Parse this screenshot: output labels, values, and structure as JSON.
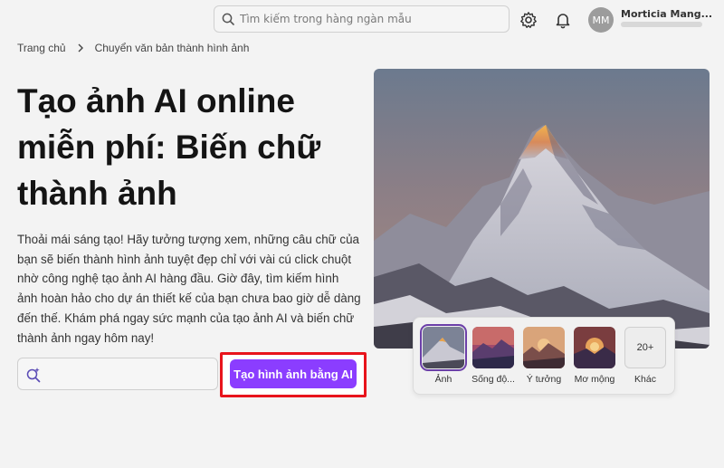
{
  "header": {
    "search_placeholder": "Tìm kiếm trong hàng ngàn mẫu",
    "user_initials": "MM",
    "user_name": "Morticia Mang..."
  },
  "breadcrumb": {
    "home": "Trang chủ",
    "current": "Chuyển văn bản thành hình ảnh"
  },
  "hero": {
    "title": "Tạo ảnh AI online miễn phí: Biến chữ thành ảnh",
    "description": "Thoải mái sáng tạo! Hãy tưởng tượng xem, những câu chữ của bạn sẽ biến thành hình ảnh tuyệt đẹp chỉ với vài cú click chuột nhờ công nghệ tạo ảnh AI hàng đầu. Giờ đây, tìm kiếm hình ảnh hoàn hảo cho dự án thiết kế của bạn chưa bao giờ dễ dàng đến thế. Khám phá ngay sức mạnh của tạo ảnh AI và biến chữ thành ảnh ngay hôm nay!"
  },
  "prompt": {
    "value": "",
    "cta_label": "Tạo hình ảnh bằng AI"
  },
  "styles": [
    {
      "label": "Ảnh",
      "selected": true
    },
    {
      "label": "Sống độ...",
      "selected": false
    },
    {
      "label": "Ý tưởng",
      "selected": false
    },
    {
      "label": "Mơ mộng",
      "selected": false
    },
    {
      "label": "Khác",
      "badge": "20+",
      "selected": false
    }
  ],
  "colors": {
    "accent": "#8b3dff",
    "highlight": "#e8141c",
    "selected_outline": "#6b3fa8"
  },
  "icons": {
    "search": "search-icon",
    "settings": "gear-icon",
    "notifications": "bell-icon",
    "prompt": "sparkle-search-icon",
    "breadcrumb_separator": "chevron-right-icon"
  }
}
